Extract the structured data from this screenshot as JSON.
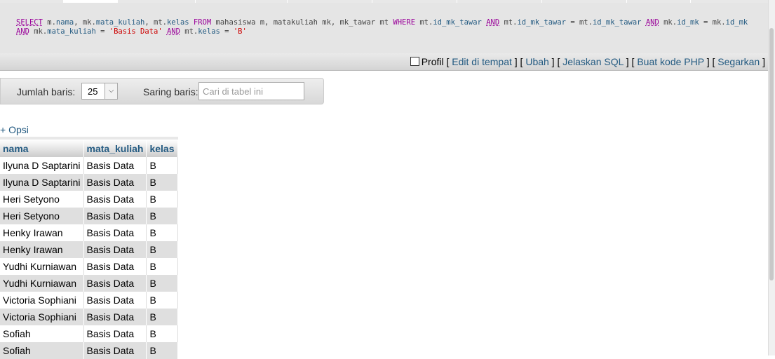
{
  "sql": {
    "parts": [
      [
        "kw",
        "SELECT"
      ],
      [
        "t",
        " "
      ],
      [
        "t",
        "m."
      ],
      [
        "col",
        "nama"
      ],
      [
        "t",
        ", mk."
      ],
      [
        "col",
        "mata_kuliah"
      ],
      [
        "t",
        ", mt."
      ],
      [
        "col",
        "kelas"
      ],
      [
        "t",
        " "
      ],
      [
        "kw2",
        "FROM"
      ],
      [
        "t",
        " mahasiswa m, matakuliah mk, mk_tawar mt "
      ],
      [
        "kw2",
        "WHERE"
      ],
      [
        "t",
        " mt."
      ],
      [
        "col",
        "id_mk_tawar"
      ],
      [
        "t",
        " "
      ],
      [
        "kw",
        "AND"
      ],
      [
        "t",
        " mt."
      ],
      [
        "col",
        "id_mk_tawar"
      ],
      [
        "t",
        " = mt."
      ],
      [
        "col",
        "id_mk_tawar"
      ],
      [
        "t",
        " "
      ],
      [
        "kw",
        "AND"
      ],
      [
        "t",
        " "
      ],
      [
        "t",
        "mk."
      ],
      [
        "col",
        "id_mk"
      ],
      [
        "t",
        " = mk."
      ],
      [
        "col",
        "id_mk"
      ],
      [
        "t",
        " "
      ],
      [
        "kw",
        "AND"
      ],
      [
        "t",
        " mk."
      ],
      [
        "col",
        "mata_kuliah"
      ],
      [
        "t",
        " = "
      ],
      [
        "str",
        "'Basis Data'"
      ],
      [
        "t",
        " "
      ],
      [
        "kw",
        "AND"
      ],
      [
        "t",
        " mt."
      ],
      [
        "col",
        "kelas"
      ],
      [
        "t",
        " = "
      ],
      [
        "str",
        "'B'"
      ]
    ]
  },
  "sqlbar": {
    "profil": "Profil",
    "edit": "Edit di tempat",
    "ubah": "Ubah",
    "jelaskan": "Jelaskan SQL",
    "php": "Buat kode PHP",
    "segarkan": "Segarkan"
  },
  "nav": {
    "rows_label": "Jumlah baris:",
    "rows_value": "25",
    "filter_label": "Saring baris:",
    "filter_placeholder": "Cari di tabel ini"
  },
  "opsi": "+ Opsi",
  "table": {
    "headers": [
      "nama",
      "mata_kuliah",
      "kelas"
    ],
    "rows": [
      [
        "Ilyuna D Saptarini",
        "Basis Data",
        "B"
      ],
      [
        "Ilyuna D Saptarini",
        "Basis Data",
        "B"
      ],
      [
        "Heri Setyono",
        "Basis Data",
        "B"
      ],
      [
        "Heri Setyono",
        "Basis Data",
        "B"
      ],
      [
        "Henky Irawan",
        "Basis Data",
        "B"
      ],
      [
        "Henky Irawan",
        "Basis Data",
        "B"
      ],
      [
        "Yudhi Kurniawan",
        "Basis Data",
        "B"
      ],
      [
        "Yudhi Kurniawan",
        "Basis Data",
        "B"
      ],
      [
        "Victoria Sophiani",
        "Basis Data",
        "B"
      ],
      [
        "Victoria Sophiani",
        "Basis Data",
        "B"
      ],
      [
        "Sofiah",
        "Basis Data",
        "B"
      ],
      [
        "Sofiah",
        "Basis Data",
        "B"
      ]
    ]
  }
}
